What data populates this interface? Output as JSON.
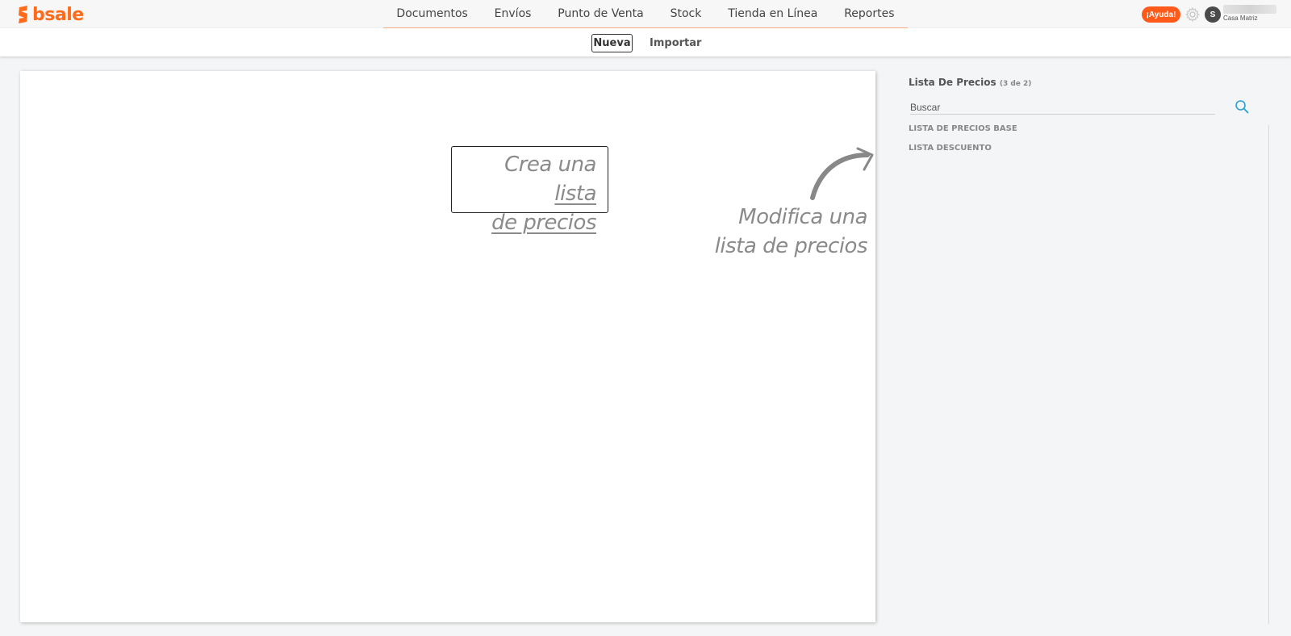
{
  "brand": {
    "name": "bsale",
    "accent": "#ff6b1a"
  },
  "nav": {
    "items": [
      "Documentos",
      "Envíos",
      "Punto de Venta",
      "Stock",
      "Tienda en Línea",
      "Reportes"
    ]
  },
  "header": {
    "help_label": "¡Ayuda!",
    "settings_icon": "gear-icon",
    "avatar_initial": "S",
    "branch": "Casa Matriz"
  },
  "subnav": {
    "new_label": "Nueva",
    "import_label": "Importar"
  },
  "main": {
    "hint_create_line1_a": "Crea una ",
    "hint_create_line1_b": "lista",
    "hint_create_line2": "de precios",
    "hint_modify_line1": "Modifica una",
    "hint_modify_line2": "lista de precios"
  },
  "sidebar": {
    "title": "Lista De Precios",
    "count": "(3 de 2)",
    "search_placeholder": "Buscar",
    "items": [
      "LISTA DE PRECIOS BASE",
      "LISTA DESCUENTO"
    ]
  }
}
